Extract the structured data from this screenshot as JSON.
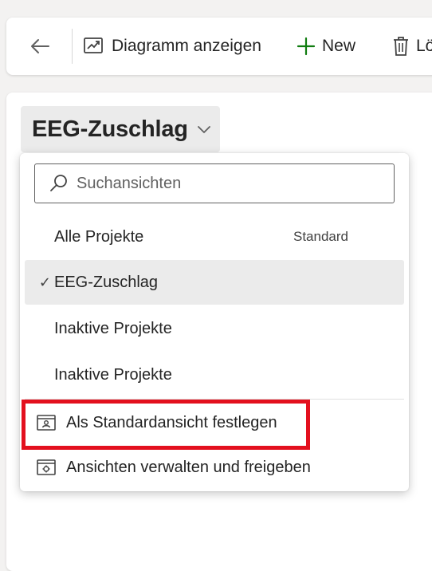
{
  "command_bar": {
    "back_icon": "back-arrow-icon",
    "show_chart_label": "Diagramm anzeigen",
    "show_chart_icon": "chart-icon",
    "new_label": "New",
    "new_icon": "plus-icon",
    "new_icon_color": "#107c10",
    "delete_label": "Lö",
    "delete_icon": "trash-icon"
  },
  "view_selector": {
    "title": "EEG-Zuschlag",
    "chevron_icon": "chevron-down-icon"
  },
  "dropdown": {
    "search": {
      "placeholder": "Suchansichten",
      "value": "",
      "icon": "search-icon"
    },
    "views": [
      {
        "label": "Alle Projekte",
        "badge": "Standard",
        "checked": false
      },
      {
        "label": "EEG-Zuschlag",
        "badge": "",
        "checked": true,
        "check_mark": "✓"
      },
      {
        "label": "Inaktive Projekte",
        "badge": "",
        "checked": false
      },
      {
        "label": "Inaktive Projekte",
        "badge": "",
        "checked": false
      }
    ],
    "actions": [
      {
        "label": "Als Standardansicht festlegen",
        "icon": "set-default-view-icon",
        "highlighted": true
      },
      {
        "label": "Ansichten verwalten und freigeben",
        "icon": "manage-views-icon"
      }
    ]
  },
  "colors": {
    "highlight_border": "#e3101e",
    "selected_bg": "#ebebeb",
    "accent_green": "#107c10"
  }
}
